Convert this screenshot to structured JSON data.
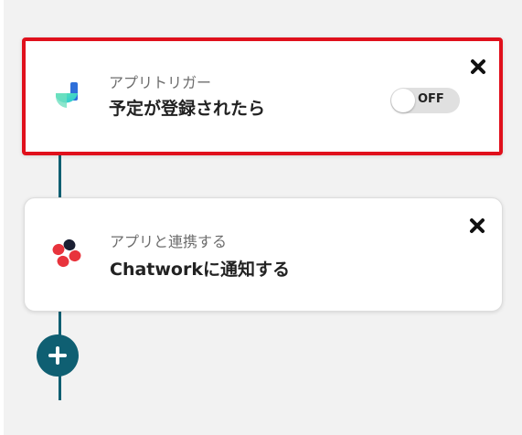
{
  "flow": {
    "trigger": {
      "category_label": "アプリトリガー",
      "title": "予定が登録されたら",
      "app_icon": "timerex-icon",
      "toggle_label": "OFF",
      "toggle_state": "off",
      "selected": true,
      "highlight_color": "#e0101c"
    },
    "action": {
      "category_label": "アプリと連携する",
      "title": "Chatworkに通知する",
      "app_icon": "chatwork-icon"
    },
    "add_button_icon": "plus-icon",
    "connector_color": "#0f5f72"
  }
}
